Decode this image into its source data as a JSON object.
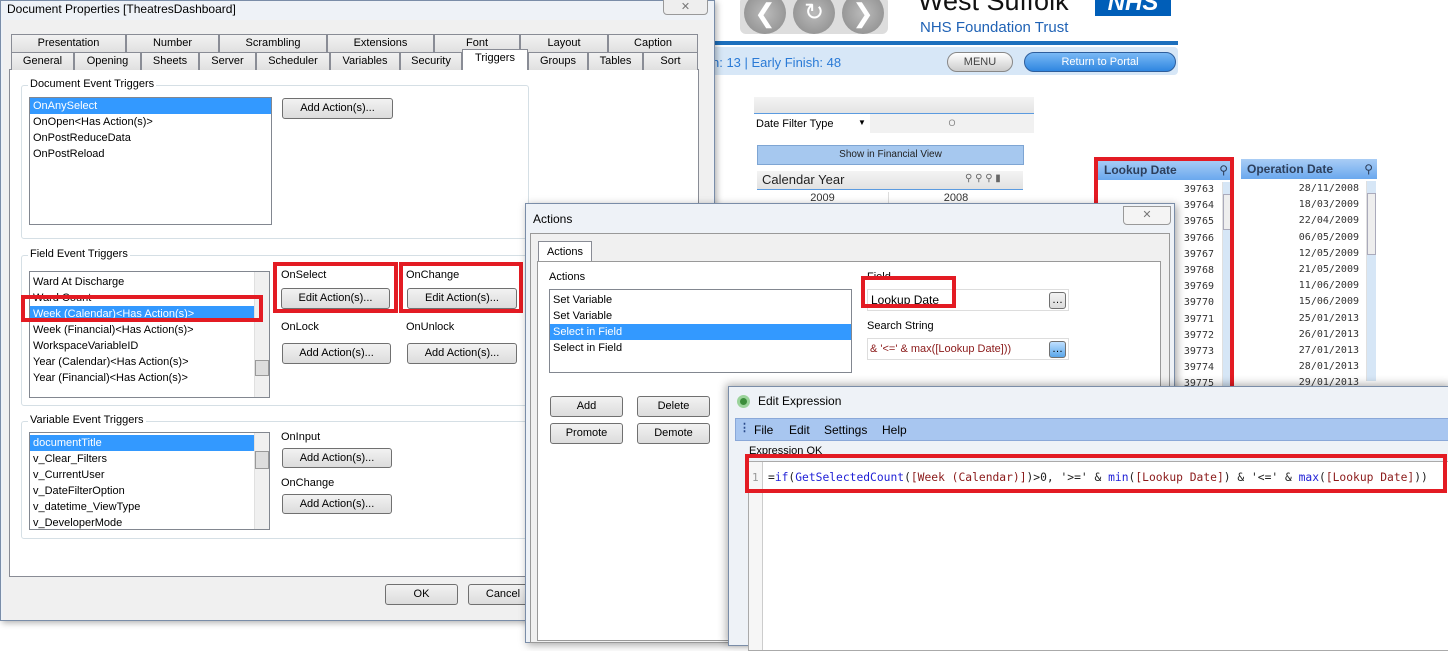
{
  "app": {
    "brand_title": "West Suffolk",
    "brand_logo": "NHS",
    "brand_subtitle": "NHS Foundation Trust",
    "nav_icons": [
      "back-arrow-icon",
      "refresh-icon",
      "forward-arrow-icon"
    ],
    "status_text": "n: 13 | Early Finish: 48",
    "menu_label": "MENU",
    "portal_label": "Return to Portal",
    "date_filter_label": "Date Filter Type",
    "date_filter_value": "O",
    "financial_button": "Show in Financial View",
    "calendar_year_title": "Calendar Year",
    "calendar_years": [
      "2009",
      "2008"
    ],
    "lookup_title": "Lookup Date",
    "lookup_values": [
      "39763",
      "39764",
      "39765",
      "39766",
      "39767",
      "39768",
      "39769",
      "39770",
      "39771",
      "39772",
      "39773",
      "39774",
      "39775"
    ],
    "operation_title": "Operation Date",
    "operation_values": [
      "28/11/2008",
      "18/03/2009",
      "22/04/2009",
      "06/05/2009",
      "12/05/2009",
      "21/05/2009",
      "11/06/2009",
      "15/06/2009",
      "25/01/2013",
      "26/01/2013",
      "27/01/2013",
      "28/01/2013",
      "29/01/2013"
    ]
  },
  "doc_props": {
    "title": "Document Properties [TheatresDashboard]",
    "tabs_row1": [
      "Presentation",
      "Number",
      "Scrambling",
      "Extensions",
      "Font",
      "Layout",
      "Caption"
    ],
    "tabs_row2": [
      "General",
      "Opening",
      "Sheets",
      "Server",
      "Scheduler",
      "Variables",
      "Security",
      "Triggers",
      "Groups",
      "Tables",
      "Sort"
    ],
    "active_tab": "Triggers",
    "doc_group": "Document Event Triggers",
    "doc_items": [
      "OnAnySelect",
      "OnOpen<Has Action(s)>",
      "OnPostReduceData",
      "OnPostReload"
    ],
    "doc_selected": 0,
    "add_action": "Add Action(s)...",
    "edit_action": "Edit Action(s)...",
    "field_group": "Field Event Triggers",
    "field_items": [
      "Ward At Discharge",
      "Ward Count",
      "Week (Calendar)<Has Action(s)>",
      "Week (Financial)<Has Action(s)>",
      "WorkspaceVariableID",
      "Year (Calendar)<Has Action(s)>",
      "Year (Financial)<Has Action(s)>"
    ],
    "field_selected": 2,
    "on_select": "OnSelect",
    "on_change": "OnChange",
    "on_lock": "OnLock",
    "on_unlock": "OnUnlock",
    "var_group": "Variable Event Triggers",
    "var_items": [
      "documentTitle",
      "v_Clear_Filters",
      "v_CurrentUser",
      "v_DateFilterOption",
      "v_datetime_ViewType",
      "v_DeveloperMode"
    ],
    "var_selected": 0,
    "on_input": "OnInput",
    "ok": "OK",
    "cancel": "Cancel"
  },
  "actions": {
    "title": "Actions",
    "tab": "Actions",
    "list_label": "Actions",
    "items": [
      "Set Variable",
      "Set Variable",
      "Select in Field",
      "Select in Field"
    ],
    "selected": 2,
    "field_label": "Field",
    "field_value": "Lookup Date",
    "search_label": "Search String",
    "search_value": "& '<=' & max([Lookup Date]))",
    "add": "Add",
    "delete": "Delete",
    "promote": "Promote",
    "demote": "Demote"
  },
  "expression": {
    "title": "Edit Expression",
    "menu": [
      "File",
      "Edit",
      "Settings",
      "Help"
    ],
    "status": "Expression OK",
    "line_number": "1",
    "tokens": [
      {
        "t": "=",
        "c": "str"
      },
      {
        "t": "if",
        "c": "kw"
      },
      {
        "t": "(",
        "c": "str"
      },
      {
        "t": "GetSelectedCount",
        "c": "kw"
      },
      {
        "t": "(",
        "c": "str"
      },
      {
        "t": "[Week (Calendar)]",
        "c": "fld"
      },
      {
        "t": ")>0, '>=' & ",
        "c": "str"
      },
      {
        "t": "min",
        "c": "kw"
      },
      {
        "t": "(",
        "c": "str"
      },
      {
        "t": "[Lookup Date]",
        "c": "fld"
      },
      {
        "t": ") & '<=' & ",
        "c": "str"
      },
      {
        "t": "max",
        "c": "kw"
      },
      {
        "t": "(",
        "c": "str"
      },
      {
        "t": "[Lookup Date]",
        "c": "fld"
      },
      {
        "t": "))",
        "c": "str"
      }
    ]
  }
}
